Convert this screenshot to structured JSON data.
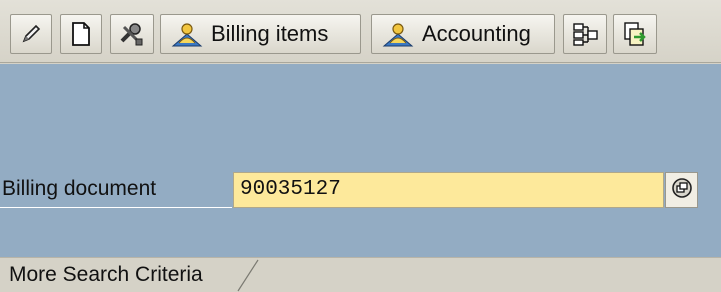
{
  "toolbar": {
    "buttons": [
      {
        "name": "change-button",
        "icon": "pencil-icon"
      },
      {
        "name": "create-button",
        "icon": "blank-document-icon"
      },
      {
        "name": "tools-button",
        "icon": "tools-icon"
      },
      {
        "name": "billing-items-button",
        "icon": "persons-icon",
        "label": "Billing items"
      },
      {
        "name": "accounting-button",
        "icon": "persons-icon",
        "label": "Accounting"
      },
      {
        "name": "hierarchy-button",
        "icon": "hierarchy-icon"
      },
      {
        "name": "output-button",
        "icon": "output-icon"
      }
    ]
  },
  "form": {
    "billing_document_label": "Billing document",
    "billing_document_value": "90035127",
    "value_help_icon": "value-help-icon",
    "input_background": "#fde99b"
  },
  "tabs": [
    {
      "label": "More Search Criteria"
    }
  ],
  "colors": {
    "screen_background": "#93acc3",
    "toolbar_background": "#dedbd1"
  }
}
